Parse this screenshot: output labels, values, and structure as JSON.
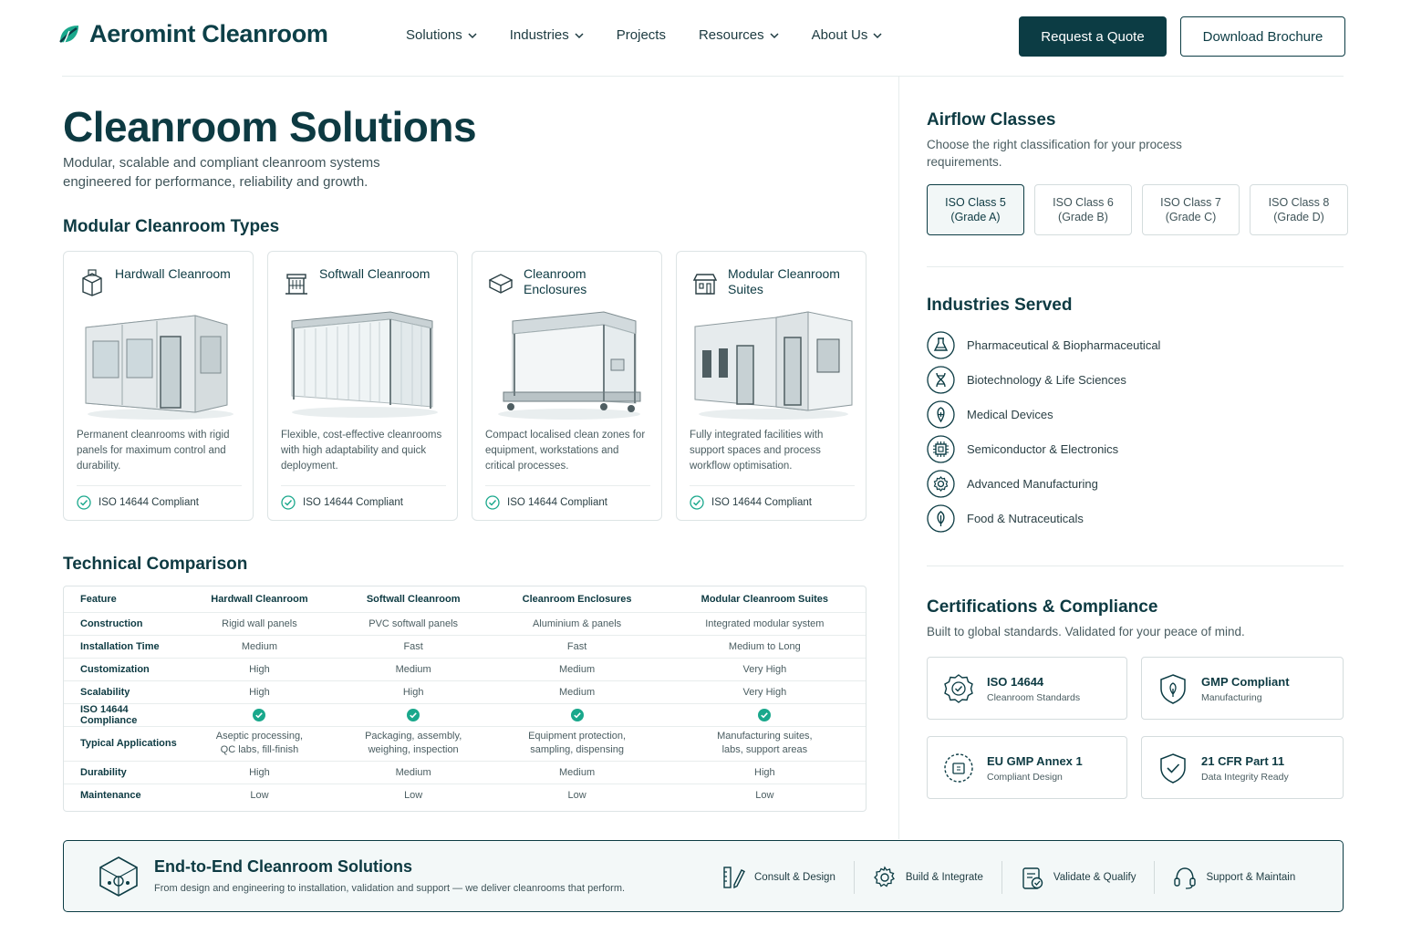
{
  "brand": {
    "name": "Aeromint Cleanroom",
    "accent": "#0c3c44",
    "teal": "#1aa88c"
  },
  "nav": {
    "items": [
      {
        "label": "Solutions",
        "dropdown": true
      },
      {
        "label": "Industries",
        "dropdown": true
      },
      {
        "label": "Projects",
        "dropdown": false
      },
      {
        "label": "Resources",
        "dropdown": true
      },
      {
        "label": "About Us",
        "dropdown": true
      }
    ],
    "quote_label": "Request a Quote",
    "brochure_label": "Download Brochure"
  },
  "hero": {
    "title": "Cleanroom Solutions",
    "subtitle": "Modular, scalable and compliant cleanroom systems engineered for performance, reliability and growth."
  },
  "types": {
    "heading": "Modular Cleanroom Types",
    "cards": [
      {
        "title": "Hardwall Cleanroom",
        "icon": "hardwall-icon",
        "description": "Permanent cleanrooms with rigid panels for maximum control and durability.",
        "compliance": "ISO 14644 Compliant"
      },
      {
        "title": "Softwall Cleanroom",
        "icon": "softwall-icon",
        "description": "Flexible, cost-effective cleanrooms with high adaptability and quick deployment.",
        "compliance": "ISO 14644 Compliant"
      },
      {
        "title": "Cleanroom Enclosures",
        "icon": "cube-icon",
        "description": "Compact localised clean zones for equipment, workstations and critical processes.",
        "compliance": "ISO 14644 Compliant"
      },
      {
        "title": "Modular Cleanroom Suites",
        "icon": "building-icon",
        "description": "Fully integrated facilities with support spaces and process workflow optimisation.",
        "compliance": "ISO 14644 Compliant"
      }
    ]
  },
  "comparison": {
    "heading": "Technical Comparison",
    "columns": [
      "Feature",
      "Hardwall Cleanroom",
      "Softwall Cleanroom",
      "Cleanroom Enclosures",
      "Modular Cleanroom Suites"
    ],
    "rows": [
      {
        "feature": "Construction",
        "values": [
          "Rigid wall panels",
          "PVC softwall panels",
          "Aluminium & panels",
          "Integrated modular system"
        ]
      },
      {
        "feature": "Installation Time",
        "values": [
          "Medium",
          "Fast",
          "Fast",
          "Medium to Long"
        ]
      },
      {
        "feature": "Customization",
        "values": [
          "High",
          "Medium",
          "Medium",
          "Very High"
        ]
      },
      {
        "feature": "Scalability",
        "values": [
          "High",
          "High",
          "Medium",
          "Very High"
        ]
      },
      {
        "feature": "ISO 14644 Compliance",
        "values": [
          "check",
          "check",
          "check",
          "check"
        ]
      },
      {
        "feature": "Typical Applications",
        "values": [
          "Aseptic processing,\nQC labs, fill-finish",
          "Packaging, assembly,\nweighing, inspection",
          "Equipment protection,\nsampling, dispensing",
          "Manufacturing suites,\nlabs, support areas"
        ]
      },
      {
        "feature": "Durability",
        "values": [
          "High",
          "Medium",
          "Medium",
          "High"
        ]
      },
      {
        "feature": "Maintenance",
        "values": [
          "Low",
          "Low",
          "Low",
          "Low"
        ]
      }
    ]
  },
  "airflow": {
    "heading": "Airflow Classes",
    "subtitle": "Choose the right classification for your process requirements.",
    "classes": [
      {
        "line1": "ISO Class 5",
        "line2": "(Grade A)",
        "active": true
      },
      {
        "line1": "ISO Class 6",
        "line2": "(Grade B)",
        "active": false
      },
      {
        "line1": "ISO Class 7",
        "line2": "(Grade C)",
        "active": false
      },
      {
        "line1": "ISO Class 8",
        "line2": "(Grade D)",
        "active": false
      }
    ]
  },
  "industries": {
    "heading": "Industries Served",
    "items": [
      {
        "label": "Pharmaceutical & Biopharmaceutical",
        "icon": "flask-icon"
      },
      {
        "label": "Biotechnology & Life Sciences",
        "icon": "dna-icon"
      },
      {
        "label": "Medical Devices",
        "icon": "medical-device-icon"
      },
      {
        "label": "Semiconductor & Electronics",
        "icon": "chip-icon"
      },
      {
        "label": "Advanced Manufacturing",
        "icon": "gear-icon"
      },
      {
        "label": "Food & Nutraceuticals",
        "icon": "leaf-icon"
      }
    ]
  },
  "certifications": {
    "heading": "Certifications & Compliance",
    "subtitle": "Built to global standards. Validated for your peace of mind.",
    "items": [
      {
        "name": "ISO 14644",
        "desc": "Cleanroom Standards",
        "icon": "iso-badge-icon"
      },
      {
        "name": "GMP Compliant",
        "desc": "Manufacturing",
        "icon": "gmp-shield-icon"
      },
      {
        "name": "EU GMP Annex 1",
        "desc": "Compliant Design",
        "icon": "eu-badge-icon"
      },
      {
        "name": "21 CFR Part 11",
        "desc": "Data Integrity Ready",
        "icon": "shield-check-icon"
      }
    ]
  },
  "banner": {
    "title": "End-to-End Cleanroom Solutions",
    "subtitle": "From design and engineering to installation, validation and support — we deliver cleanrooms that perform.",
    "steps": [
      {
        "label": "Consult & Design",
        "icon": "pencil-ruler-icon"
      },
      {
        "label": "Build & Integrate",
        "icon": "gear-icon"
      },
      {
        "label": "Validate & Qualify",
        "icon": "clipboard-check-icon"
      },
      {
        "label": "Support & Maintain",
        "icon": "headset-icon"
      }
    ]
  }
}
